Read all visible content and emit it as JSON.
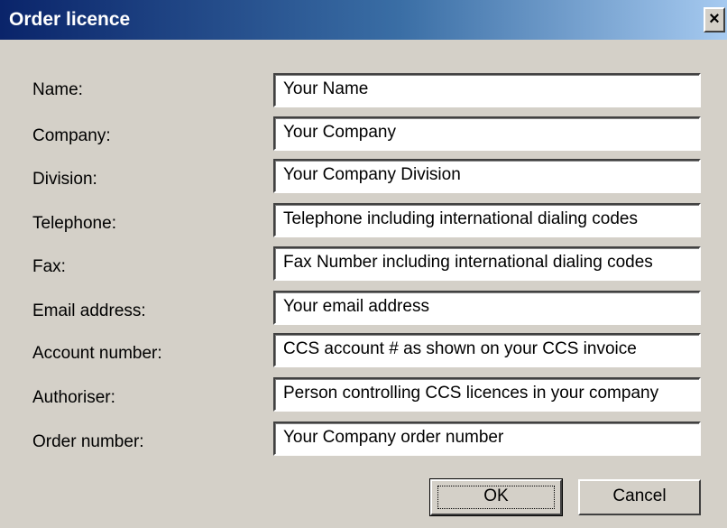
{
  "dialog": {
    "title": "Order licence",
    "close_glyph": "×"
  },
  "fields": [
    {
      "label": "Name:",
      "value": "Your Name"
    },
    {
      "label": "Company:",
      "value": "Your Company"
    },
    {
      "label": "Division:",
      "value": "Your Company Division"
    },
    {
      "label": "Telephone:",
      "value": "Telephone including international dialing codes"
    },
    {
      "label": "Fax:",
      "value": "Fax Number including international dialing codes"
    },
    {
      "label": "Email address:",
      "value": "Your email address"
    },
    {
      "label": "Account number:",
      "value": "CCS account # as shown on your CCS invoice"
    },
    {
      "label": "Authoriser:",
      "value": "Person controlling CCS licences in your company"
    },
    {
      "label": "Order number:",
      "value": "Your Company order number"
    }
  ],
  "buttons": {
    "ok_label": "OK",
    "cancel_label": "Cancel"
  },
  "colors": {
    "title_bar_start": "#0a246a",
    "title_bar_end": "#a6caf0",
    "face": "#d4d0c8"
  },
  "icons": {
    "close": "close-icon"
  }
}
